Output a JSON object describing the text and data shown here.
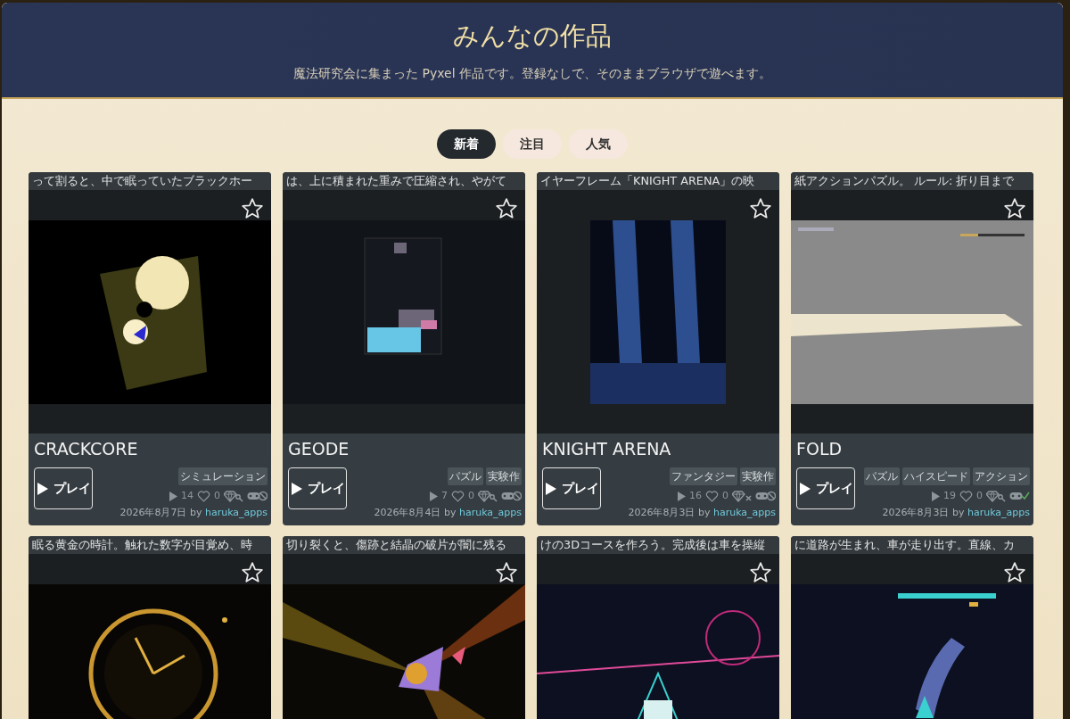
{
  "header": {
    "title": "みんなの作品",
    "subtitle": "魔法研究会に集まった Pyxel 作品です。登録なしで、そのままブラウザで遊べます。"
  },
  "tabs": [
    {
      "label": "新着",
      "selected": true
    },
    {
      "label": "注目",
      "selected": false
    },
    {
      "label": "人気",
      "selected": false
    }
  ],
  "cards": [
    {
      "description": "って割ると、中で眠っていたブラックホー",
      "favorited": false,
      "title": "CRACKCORE",
      "play_label": "プレイ",
      "tags": [
        "シミュレーション"
      ],
      "plays": "14",
      "likes": "0",
      "gem_unlocked": true,
      "pad_supported": false,
      "date": "2026年8月7日 by",
      "author": "haruka_apps"
    },
    {
      "description": "は、上に積まれた重みで圧縮され、やがて",
      "favorited": false,
      "title": "GEODE",
      "play_label": "プレイ",
      "tags": [
        "パズル",
        "実験作"
      ],
      "plays": "7",
      "likes": "0",
      "gem_unlocked": true,
      "pad_supported": false,
      "date": "2026年8月4日 by",
      "author": "haruka_apps"
    },
    {
      "description": "イヤーフレーム「KNIGHT ARENA」の映",
      "favorited": false,
      "title": "KNIGHT ARENA",
      "play_label": "プレイ",
      "tags": [
        "ファンタジー",
        "実験作"
      ],
      "plays": "16",
      "likes": "0",
      "gem_unlocked": false,
      "pad_supported": false,
      "date": "2026年8月3日 by",
      "author": "haruka_apps"
    },
    {
      "description": "紙アクションパズル。 ルール: 折り目まで",
      "favorited": false,
      "title": "FOLD",
      "play_label": "プレイ",
      "tags": [
        "パズル",
        "ハイスピード",
        "アクション"
      ],
      "plays": "19",
      "likes": "0",
      "gem_unlocked": true,
      "pad_supported": true,
      "date": "2026年8月3日 by",
      "author": "haruka_apps"
    },
    {
      "description": "眠る黄金の時計。触れた数字が目覚め、時",
      "favorited": false
    },
    {
      "description": "切り裂くと、傷跡と結晶の破片が闇に残る",
      "favorited": false
    },
    {
      "description": "けの3Dコースを作ろう。完成後は車を操縦",
      "favorited": false
    },
    {
      "description": "に道路が生まれ、車が走り出す。直線、カ",
      "favorited": false
    }
  ]
}
